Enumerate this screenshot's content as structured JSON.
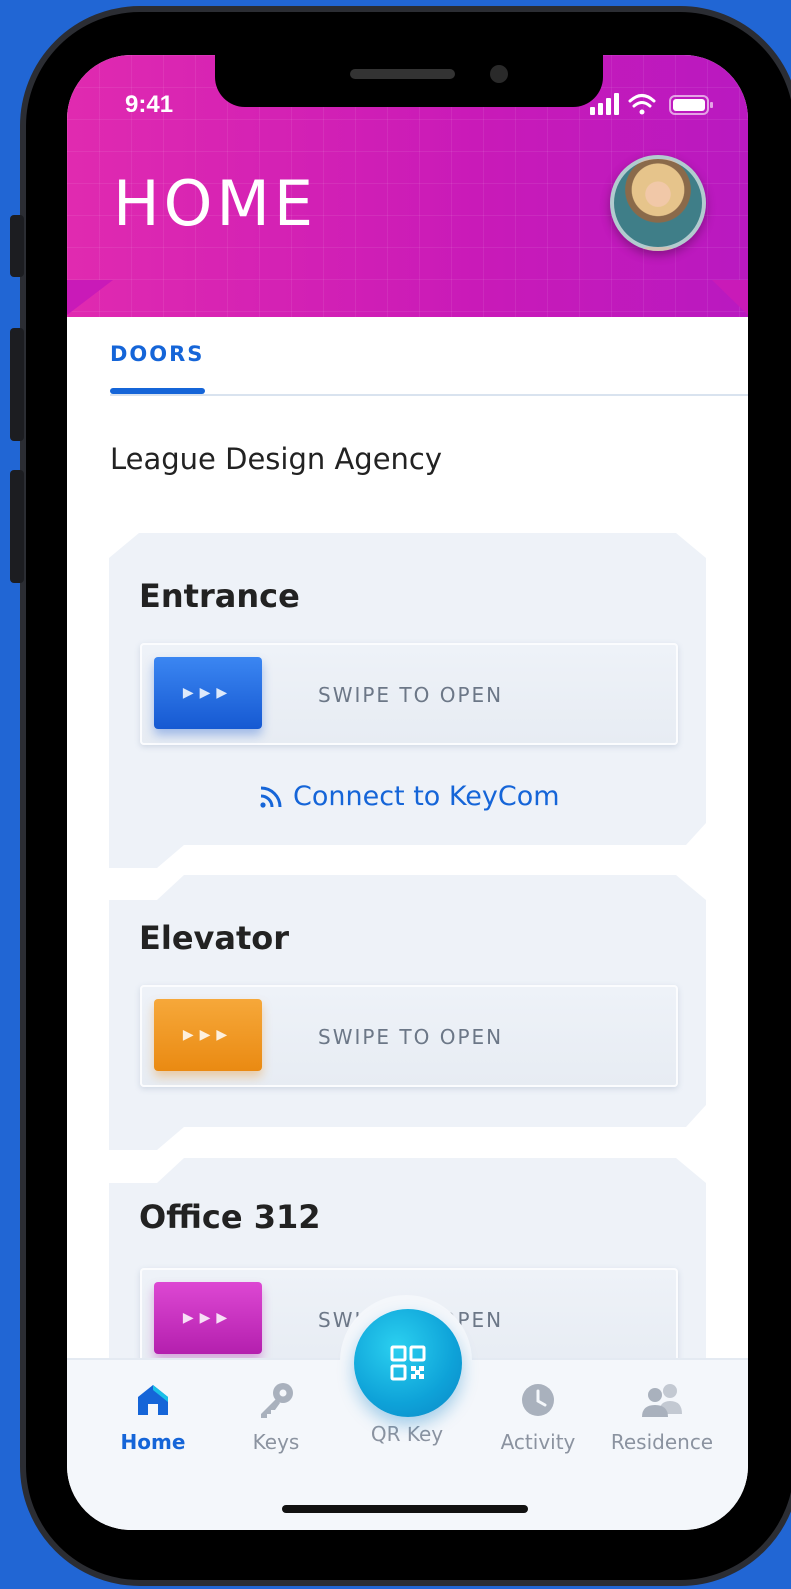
{
  "status_bar": {
    "time": "9:41"
  },
  "header": {
    "title": "HOME"
  },
  "tabs": [
    {
      "label": "DOORS",
      "active": true
    }
  ],
  "company": "League Design Agency",
  "doors": [
    {
      "name": "Entrance",
      "swipe_label": "SWIPE TO OPEN",
      "knob_color": "#1f6fe6",
      "connect_label": "Connect to KeyCom"
    },
    {
      "name": "Elevator",
      "swipe_label": "SWIPE TO OPEN",
      "knob_color": "#f0961e"
    },
    {
      "name": "Office 312",
      "swipe_label": "SWIPE TO OPEN",
      "knob_color": "#d235c8"
    }
  ],
  "nav": [
    {
      "label": "Home",
      "icon": "home-icon",
      "active": true
    },
    {
      "label": "Keys",
      "icon": "key-icon"
    },
    {
      "label": "QR Key",
      "icon": "qr-code-icon"
    },
    {
      "label": "Activity",
      "icon": "clock-icon"
    },
    {
      "label": "Residence",
      "icon": "people-icon"
    }
  ],
  "colors": {
    "accent": "#1565d8",
    "header": "#d021b4",
    "background": "#2166d4"
  }
}
